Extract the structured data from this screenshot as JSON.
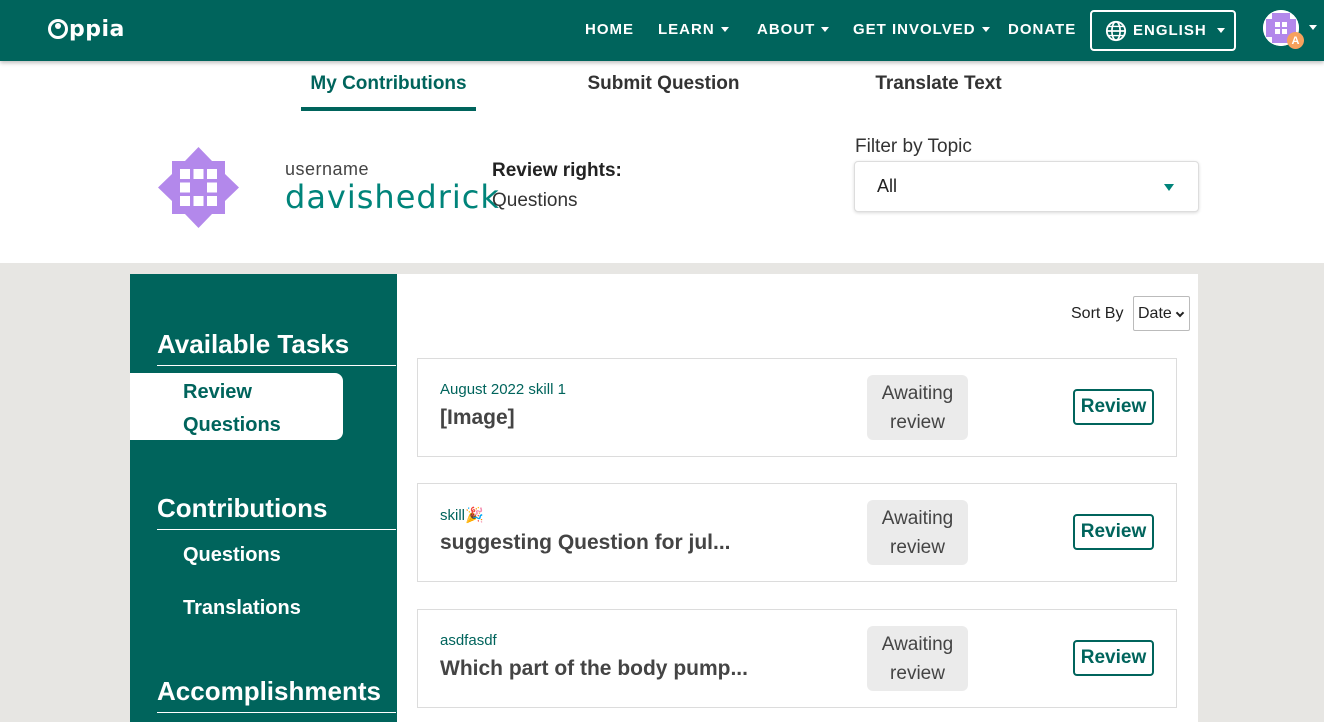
{
  "nav": {
    "logo": "ppia",
    "items": [
      {
        "label": "HOME",
        "dropdown": false
      },
      {
        "label": "LEARN",
        "dropdown": true
      },
      {
        "label": "ABOUT",
        "dropdown": true
      },
      {
        "label": "GET INVOLVED",
        "dropdown": true
      },
      {
        "label": "DONATE",
        "dropdown": false
      }
    ],
    "language": "ENGLISH",
    "avatar_badge": "A"
  },
  "tabs": [
    {
      "label": "My Contributions",
      "active": true
    },
    {
      "label": "Submit Question",
      "active": false
    },
    {
      "label": "Translate Text",
      "active": false
    }
  ],
  "profile": {
    "username_label": "username",
    "username": "davishedrick",
    "rights_label": "Review rights:",
    "rights_value": "Questions"
  },
  "filter": {
    "label": "Filter by Topic",
    "selected": "All"
  },
  "sidebar": {
    "sections": [
      {
        "heading": "Available Tasks",
        "items": [
          "Review Questions"
        ]
      },
      {
        "heading": "Contributions",
        "items": [
          "Questions",
          "Translations"
        ]
      },
      {
        "heading": "Accomplishments",
        "items": []
      }
    ]
  },
  "sort": {
    "label": "Sort By",
    "selected": "Date"
  },
  "cards": [
    {
      "subtitle": "August 2022 skill 1",
      "title": "[Image]",
      "status_line1": "Awaiting",
      "status_line2": "review",
      "action": "Review"
    },
    {
      "subtitle": "skill🎉",
      "title": "suggesting Question for jul...",
      "status_line1": "Awaiting",
      "status_line2": "review",
      "action": "Review"
    },
    {
      "subtitle": "asdfasdf",
      "title": "Which part of the body pump...",
      "status_line1": "Awaiting",
      "status_line2": "review",
      "action": "Review"
    }
  ],
  "colors": {
    "primary": "#00645c",
    "username": "#00847a",
    "background": "#e7e6e3",
    "badge": "#f7a15d",
    "avatar": "#b388eb"
  }
}
